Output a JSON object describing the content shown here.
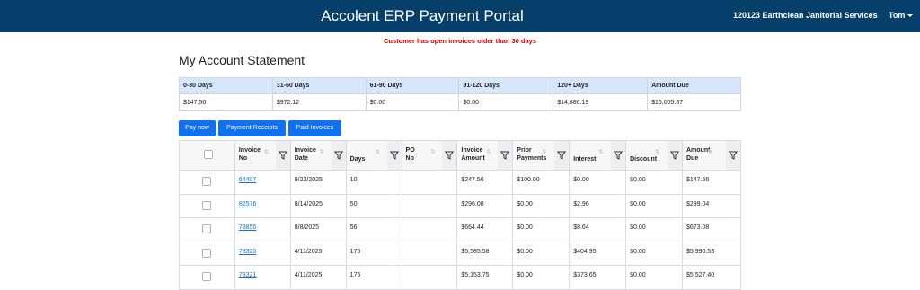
{
  "header": {
    "title": "Accolent ERP Payment Portal",
    "company": "120123 Earthclean Janitorial Services",
    "user": "Tom"
  },
  "alert": "Customer has open invoices older than 30 days",
  "page_title": "My Account Statement",
  "aging": {
    "headers": [
      "0-30 Days",
      "31-60 Days",
      "61-90 Days",
      "91-120 Days",
      "120+ Days",
      "Amount Due"
    ],
    "values": [
      "$147.56",
      "$972.12",
      "$0.00",
      "$0.00",
      "$14,886.19",
      "$16,005.87"
    ]
  },
  "buttons": {
    "pay_now": "Pay now",
    "payment_receipts": "Payment Receipts",
    "paid_invoices": "Paid Invoices"
  },
  "invoice_table": {
    "columns": [
      {
        "l1": "Invoice",
        "l2": "No"
      },
      {
        "l1": "Invoice",
        "l2": "Date"
      },
      {
        "l1": "Days",
        "l2": ""
      },
      {
        "l1": "PO",
        "l2": "No"
      },
      {
        "l1": "Invoice",
        "l2": "Amount"
      },
      {
        "l1": "Prior",
        "l2": "Payments"
      },
      {
        "l1": "Interest",
        "l2": ""
      },
      {
        "l1": "Discount",
        "l2": ""
      },
      {
        "l1": "Amount",
        "l2": "Due"
      }
    ],
    "rows": [
      {
        "invoice_no": "64407",
        "date": "9/23/2025",
        "days": "10",
        "po": "",
        "amount": "$247.56",
        "prior": "$100.00",
        "interest": "$0.00",
        "discount": "$0.00",
        "due": "$147.56"
      },
      {
        "invoice_no": "82576",
        "date": "8/14/2025",
        "days": "50",
        "po": "",
        "amount": "$296.08",
        "prior": "$0.00",
        "interest": "$2.96",
        "discount": "$0.00",
        "due": "$299.04"
      },
      {
        "invoice_no": "78856",
        "date": "8/8/2025",
        "days": "56",
        "po": "",
        "amount": "$664.44",
        "prior": "$0.00",
        "interest": "$8.64",
        "discount": "$0.00",
        "due": "$673.08"
      },
      {
        "invoice_no": "78320",
        "date": "4/11/2025",
        "days": "175",
        "po": "",
        "amount": "$5,585.58",
        "prior": "$0.00",
        "interest": "$404.95",
        "discount": "$0.00",
        "due": "$5,990.53"
      },
      {
        "invoice_no": "78321",
        "date": "4/11/2025",
        "days": "175",
        "po": "",
        "amount": "$5,153.75",
        "prior": "$0.00",
        "interest": "$373.65",
        "discount": "$0.00",
        "due": "$5,527.40"
      }
    ]
  },
  "icons": {
    "filter": "filter-icon",
    "sort": "sort-icon",
    "user_menu": "caret-down-icon"
  }
}
